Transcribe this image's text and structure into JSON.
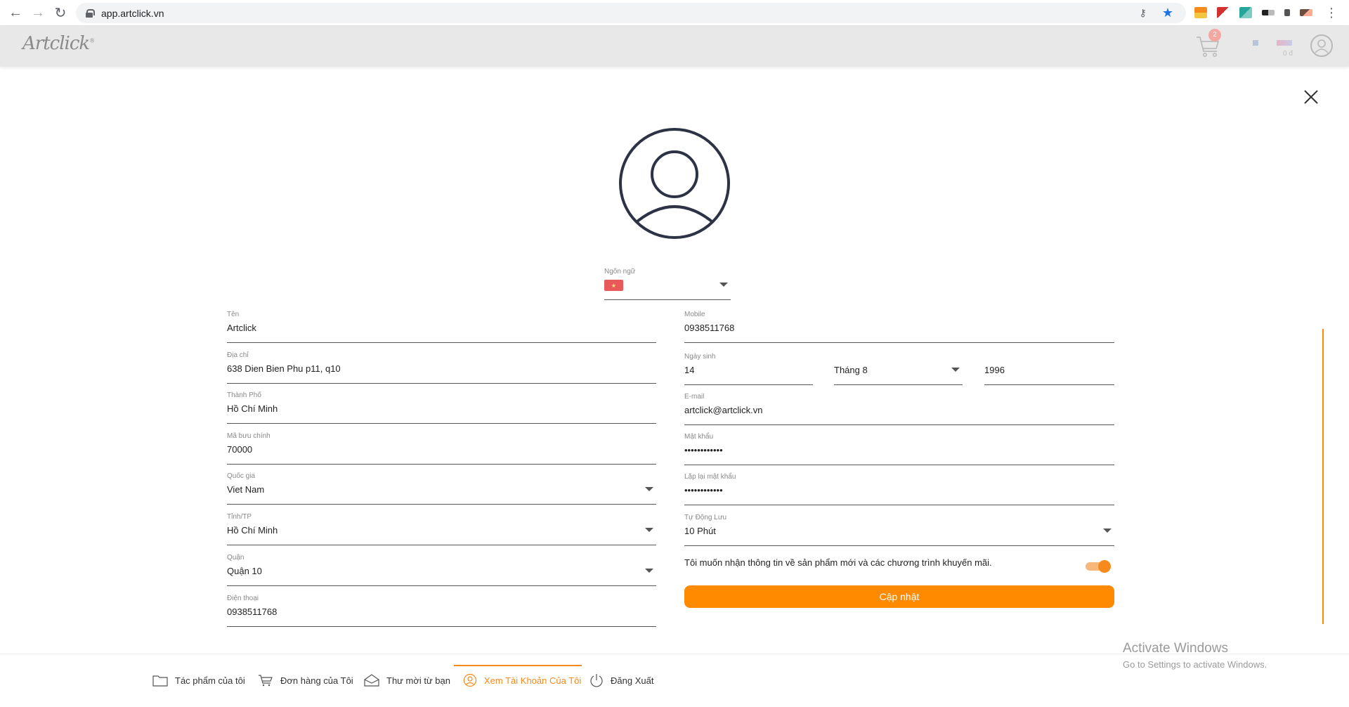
{
  "browser": {
    "url": "app.artclick.vn",
    "back": "←",
    "forward": "→",
    "reload": "↻",
    "key_icon": "key-icon",
    "star_icon": "star-icon"
  },
  "header": {
    "logo": "Artclick",
    "logo_mark": "®",
    "cart_count": "2",
    "cart_total": "0 đ"
  },
  "profile": {
    "language": {
      "label": "Ngôn ngữ",
      "flag": "★"
    },
    "left": {
      "name": {
        "label": "Tên",
        "value": "Artclick"
      },
      "address": {
        "label": "Địa chỉ",
        "value": "638 Dien Bien Phu p11, q10"
      },
      "city": {
        "label": "Thành Phố",
        "value": "Hồ Chí Minh"
      },
      "postal": {
        "label": "Mã bưu chính",
        "value": "70000"
      },
      "country": {
        "label": "Quốc gia",
        "value": "Viet Nam"
      },
      "province": {
        "label": "Tỉnh/TP",
        "value": "Hồ Chí Minh"
      },
      "district": {
        "label": "Quận",
        "value": "Quận 10"
      },
      "phone": {
        "label": "Điện thoại",
        "value": "0938511768"
      }
    },
    "right": {
      "mobile": {
        "label": "Mobile",
        "value": "0938511768"
      },
      "birthday": {
        "label": "Ngày sinh",
        "day": "14",
        "month": "Tháng 8",
        "year": "1996"
      },
      "email": {
        "label": "E-mail",
        "value": "artclick@artclick.vn"
      },
      "password": {
        "label": "Mật khẩu",
        "value": "••••••••••••"
      },
      "password_repeat": {
        "label": "Lặp lại mật khẩu",
        "value": "••••••••••••"
      },
      "autosave": {
        "label": "Tự Động Lưu",
        "value": "10 Phút"
      }
    },
    "newsletter_text": "Tôi muốn nhận thông tin về sản phẩm mới và các chương trình khuyến mãi.",
    "newsletter_on": true,
    "update_label": "Cập nhật"
  },
  "bottom_nav": [
    {
      "label": "Tác phẩm của tôi",
      "icon": "folder-icon"
    },
    {
      "label": "Đơn hàng của Tôi",
      "icon": "cart-icon"
    },
    {
      "label": "Thư mời từ bạn",
      "icon": "mail-open-icon"
    },
    {
      "label": "Xem Tài Khoản Của Tôi",
      "icon": "user-circle-icon",
      "active": true
    },
    {
      "label": "Đăng Xuất",
      "icon": "power-icon"
    }
  ],
  "watermark": {
    "title": "Activate Windows",
    "subtitle": "Go to Settings to activate Windows."
  },
  "colors": {
    "accent": "#ff8a00",
    "header_bg": "#e8e8e8"
  }
}
